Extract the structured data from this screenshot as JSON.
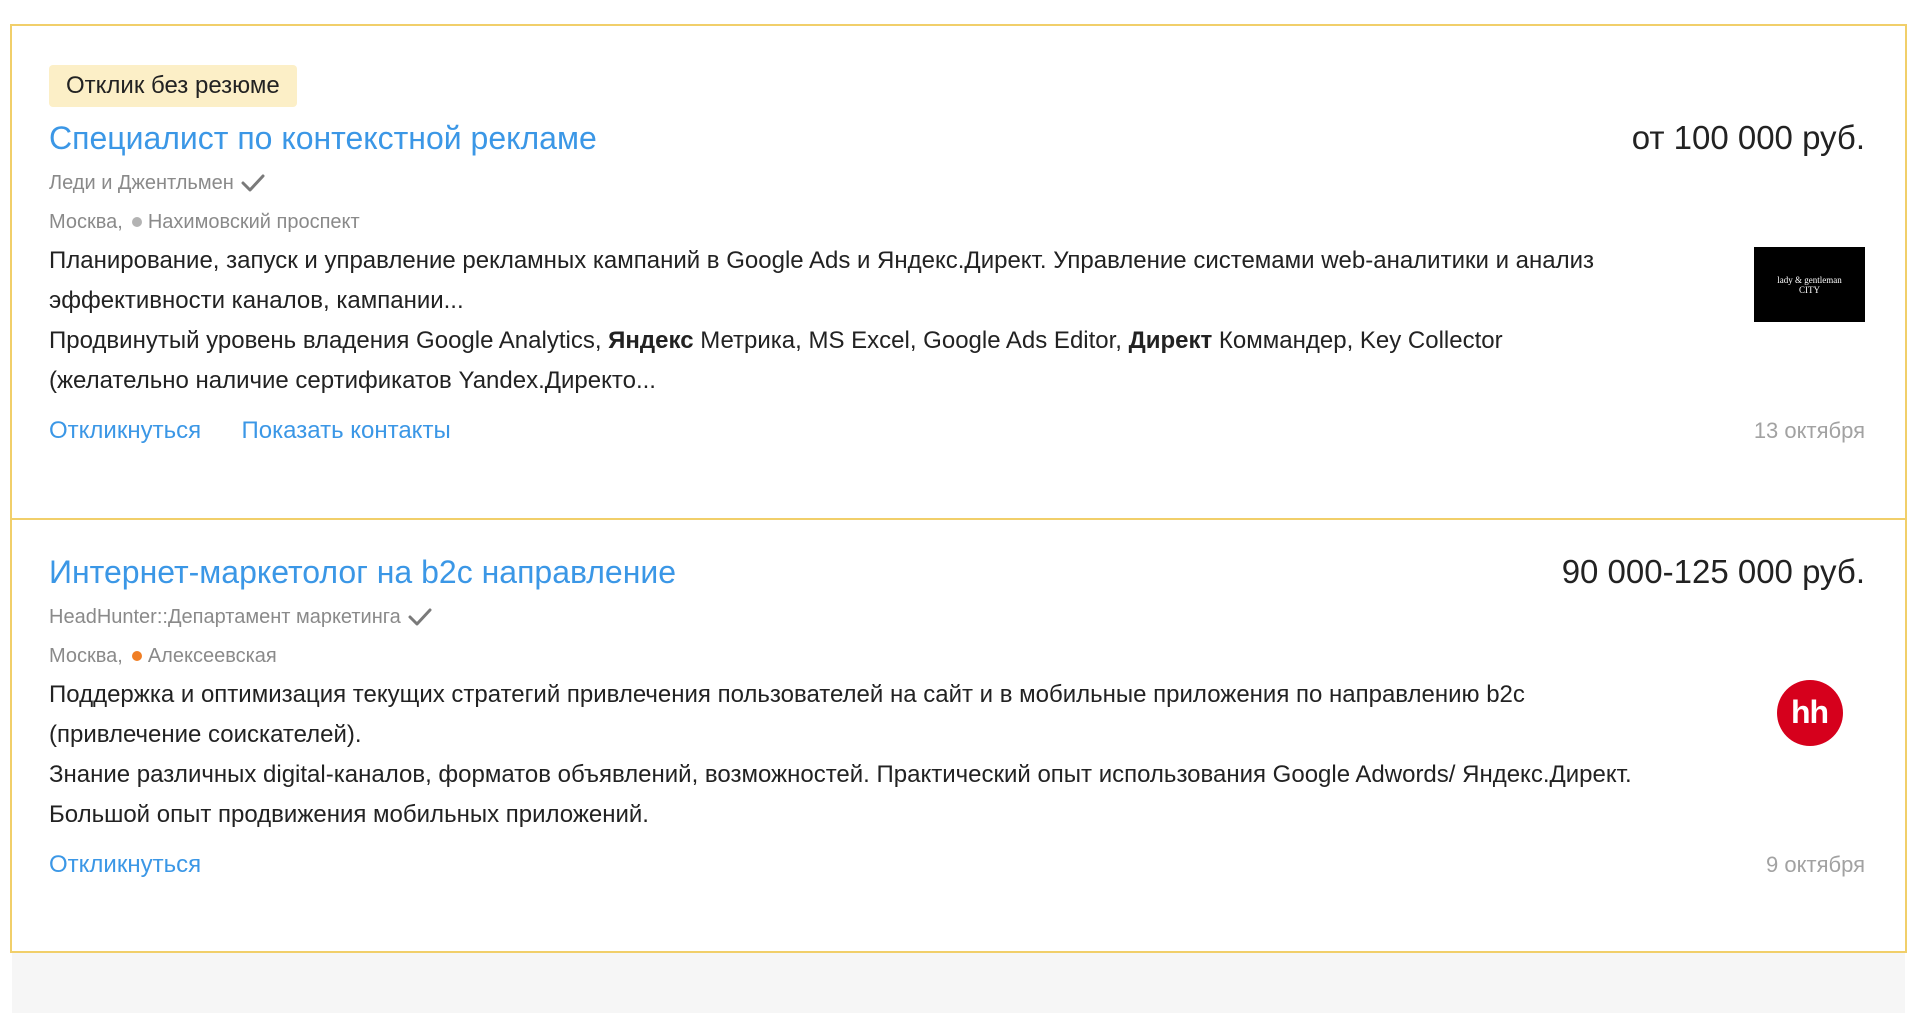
{
  "vacancies": [
    {
      "badge": "Отклик без резюме",
      "title": "Специалист по контекстной рекламе",
      "salary": "от 100 000 руб.",
      "company": "Леди и Джентльмен",
      "city": "Москва,",
      "metro": "Нахимовский проспект",
      "metro_color": "#b3b3b3",
      "description_1": "Планирование, запуск и управление рекламных кампаний в Google Ads и Яндекс.Директ. Управление системами web-аналитики и анализ эффективности каналов, кампании...",
      "description_2_a": "Продвинутый уровень владения Google Analytics, ",
      "description_2_b": "Яндекс",
      "description_2_c": " Метрика, MS Excel, Google Ads Editor, ",
      "description_2_d": "Директ",
      "description_2_e": " Коммандер, Key Collector (желательно наличие сертификатов Yandex.Директо...",
      "logo_line_1": "lady & gentleman",
      "logo_line_2": "CITY",
      "respond_label": "Откликнуться",
      "contacts_label": "Показать контакты",
      "date": "13 октября"
    },
    {
      "title": "Интернет-маркетолог на b2c направление",
      "salary": "90 000-125 000 руб.",
      "company": "HeadHunter::Департамент маркетинга",
      "city": "Москва,",
      "metro": "Алексеевская",
      "metro_color": "#f07e24",
      "description_1": "Поддержка и оптимизация текущих стратегий привлечения пользователей на сайт и в мобильные приложения по направлению b2c (привлечение соискателей).",
      "description_2": "Знание различных digital-каналов, форматов объявлений, возможностей. Практический опыт использования Google Adwords/ Яндекс.Директ. Большой опыт продвижения мобильных приложений.",
      "logo_text": "hh",
      "logo_color": "#d6001c",
      "respond_label": "Откликнуться",
      "date": "9 октября"
    }
  ]
}
